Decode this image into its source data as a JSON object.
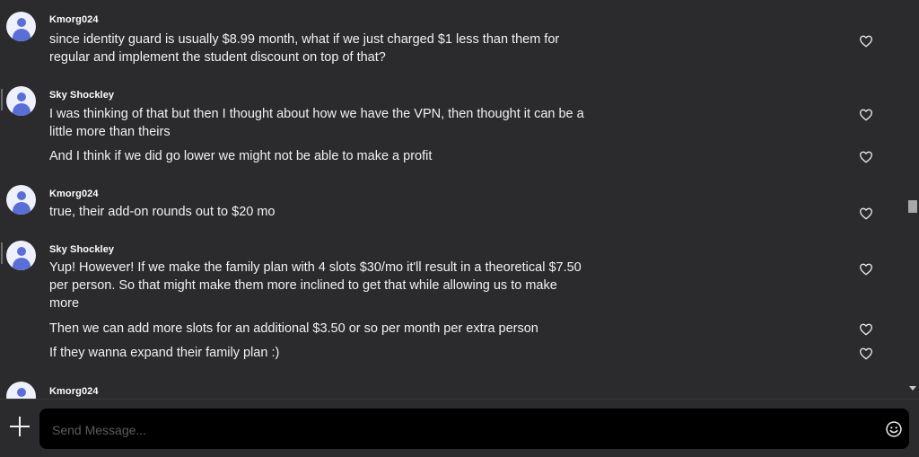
{
  "messages": [
    {
      "author": "Kmorg024",
      "lines": [
        "since identity guard is usually $8.99 month, what if we just charged $1 less than them for regular and implement the student discount on top of that?"
      ]
    },
    {
      "author": "Sky Shockley",
      "lines": [
        "I was thinking of that but then I thought about how we have the VPN, then thought it can be a little more than theirs",
        "And I think if we did go lower we might not be able to make a profit"
      ]
    },
    {
      "author": "Kmorg024",
      "lines": [
        "true, their add-on rounds out to $20 mo"
      ]
    },
    {
      "author": "Sky Shockley",
      "lines": [
        "Yup! However! If we make the family plan with 4 slots $30/mo it'll result in a theoretical $7.50 per person. So that might make them more inclined to get that while allowing us to make more",
        "Then we can add more slots for an additional $3.50 or so per month per extra person",
        "If they wanna expand their family plan :)"
      ]
    },
    {
      "author": "Kmorg024",
      "lines": []
    }
  ],
  "composer": {
    "placeholder": "Send Message..."
  },
  "icons": {
    "like": "heart-icon",
    "add": "plus-icon",
    "emoji": "smiley-icon",
    "avatar": "user-avatar-icon"
  },
  "colors": {
    "background": "#2b2a2d",
    "input": "#000000",
    "avatar": "#5a6fd6"
  }
}
